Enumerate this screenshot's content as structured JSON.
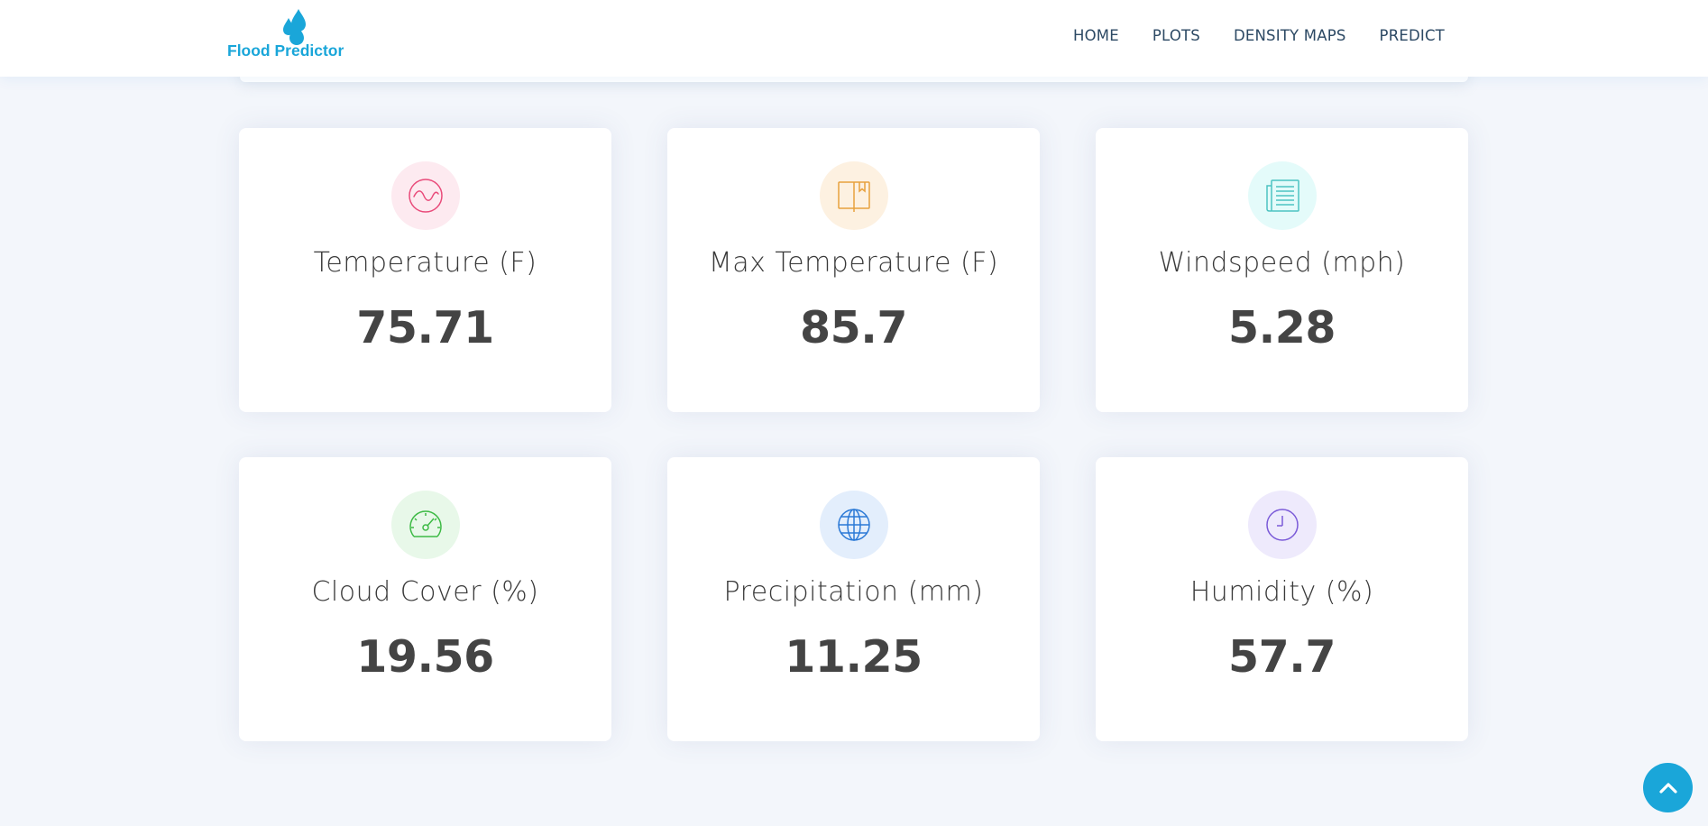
{
  "header": {
    "logo_text": "Flood Predictor",
    "nav": [
      "HOME",
      "PLOTS",
      "DENSITY MAPS",
      "PREDICT"
    ]
  },
  "cards": [
    {
      "label": "Temperature (F)",
      "value": "75.71",
      "icon": "wave-icon",
      "icon_color": "#e94b7a",
      "icon_bg": "#fdeaf0"
    },
    {
      "label": "Max Temperature (F)",
      "value": "85.7",
      "icon": "book-icon",
      "icon_color": "#e8a13d",
      "icon_bg": "#fdf1e1"
    },
    {
      "label": "Windspeed (mph)",
      "value": "5.28",
      "icon": "newspaper-icon",
      "icon_color": "#4dc3c1",
      "icon_bg": "#e4fbfa"
    },
    {
      "label": "Cloud Cover (%)",
      "value": "19.56",
      "icon": "speedometer-icon",
      "icon_color": "#3dba45",
      "icon_bg": "#e8f8e9"
    },
    {
      "label": "Precipitation (mm)",
      "value": "11.25",
      "icon": "globe-icon",
      "icon_color": "#2b79d6",
      "icon_bg": "#e3eefc"
    },
    {
      "label": "Humidity (%)",
      "value": "57.7",
      "icon": "clock-icon",
      "icon_color": "#7a5ad8",
      "icon_bg": "#eeeafc"
    }
  ],
  "colors": {
    "accent": "#1aa6d9",
    "background": "#f3f6fb",
    "nav_text": "#2c4964"
  },
  "back_to_top": {
    "icon": "chevron-up-icon"
  }
}
